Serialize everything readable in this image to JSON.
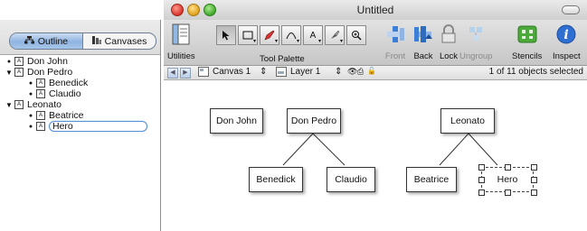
{
  "outline_panel": {
    "tabs": [
      {
        "label": "Outline",
        "icon": "outline-hierarchy-icon",
        "active": true
      },
      {
        "label": "Canvases",
        "icon": "canvases-icon",
        "active": false
      }
    ],
    "items": [
      {
        "label": "Don John",
        "level": 0,
        "expander": "bullet"
      },
      {
        "label": "Don Pedro",
        "level": 0,
        "expander": "disclosure-open"
      },
      {
        "label": "Benedick",
        "level": 1,
        "expander": "bullet"
      },
      {
        "label": "Claudio",
        "level": 1,
        "expander": "bullet"
      },
      {
        "label": "Leonato",
        "level": 0,
        "expander": "disclosure-open"
      },
      {
        "label": "Beatrice",
        "level": 1,
        "expander": "bullet"
      },
      {
        "label": "Hero",
        "level": 1,
        "expander": "bullet",
        "editing": true
      }
    ]
  },
  "window": {
    "title": "Untitled"
  },
  "toolbar": {
    "utilities_label": "Utilities",
    "tool_palette_label": "Tool Palette",
    "tools": [
      "selection-arrow-icon",
      "rectangle-shape-icon",
      "pen-tool-icon",
      "line-tool-icon",
      "text-tool-icon",
      "style-brush-icon",
      "zoom-magnifier-icon"
    ],
    "front_label": "Front",
    "back_label": "Back",
    "lock_label": "Lock",
    "ungroup_label": "Ungroup",
    "stencils_label": "Stencils",
    "inspect_label": "Inspect"
  },
  "subbar": {
    "canvas_label": "Canvas 1",
    "layer_label": "Layer 1",
    "status": "1 of 11 objects selected"
  },
  "diagram": {
    "nodes": [
      "Don John",
      "Don Pedro",
      "Benedick",
      "Claudio",
      "Leonato",
      "Beatrice",
      "Hero"
    ],
    "selected": "Hero"
  },
  "colors": {
    "selection_blue": "#90b4e0",
    "close_red": "#d8322a",
    "minimize_yellow": "#e0a11d",
    "zoom_green": "#3fa82a"
  }
}
